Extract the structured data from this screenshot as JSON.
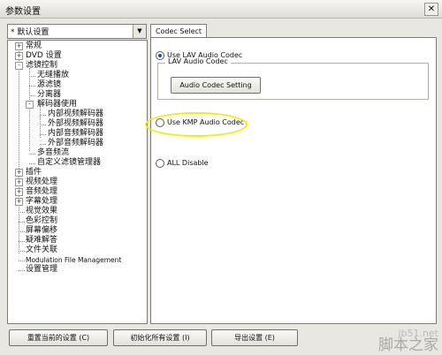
{
  "window": {
    "title": "参数设置",
    "close_glyph": "✕"
  },
  "preset": {
    "selected": "* 默认设置",
    "arrow": "▼"
  },
  "tree": {
    "expand_glyph": "+",
    "collapse_glyph": "-",
    "items": [
      {
        "label": "常规"
      },
      {
        "label": "DVD 设置"
      },
      {
        "label": "滤镜控制"
      },
      {
        "label": "无缝播放"
      },
      {
        "label": "源滤镜"
      },
      {
        "label": "分离器"
      },
      {
        "label": "解码器使用"
      },
      {
        "label": "内部视频解码器"
      },
      {
        "label": "外部视频解码器"
      },
      {
        "label": "内部音频解码器"
      },
      {
        "label": "外部音频解码器"
      },
      {
        "label": "多音频流"
      },
      {
        "label": "自定义滤镜管理器"
      },
      {
        "label": "插件"
      },
      {
        "label": "视频处理"
      },
      {
        "label": "音频处理"
      },
      {
        "label": "字幕处理"
      },
      {
        "label": "视觉效果"
      },
      {
        "label": "色彩控制"
      },
      {
        "label": "屏幕偏移"
      },
      {
        "label": "疑难解答"
      },
      {
        "label": "文件关联"
      },
      {
        "label": "Modulation File Management"
      },
      {
        "label": "设置管理"
      }
    ]
  },
  "tab": {
    "label": "Codec Select"
  },
  "codec": {
    "lav_label": "Use LAV Audio Codec",
    "group_legend": "LAV Audio Codec",
    "setting_button": "Audio Codec Setting",
    "kmp_label": "Use KMP Audio Codec",
    "disable_label": "ALL Disable"
  },
  "footer": {
    "reset_current": "重置当前的设置 (C)",
    "init_all": "初始化所有设置 (I)",
    "export": "导出设置 (E)"
  },
  "watermark": {
    "line1": "jb51.net",
    "line2": "脚本之家"
  },
  "colors": {
    "highlight": "#f2ec10",
    "radio_dot": "#1b4ea0",
    "background": "#e9e7e1"
  }
}
